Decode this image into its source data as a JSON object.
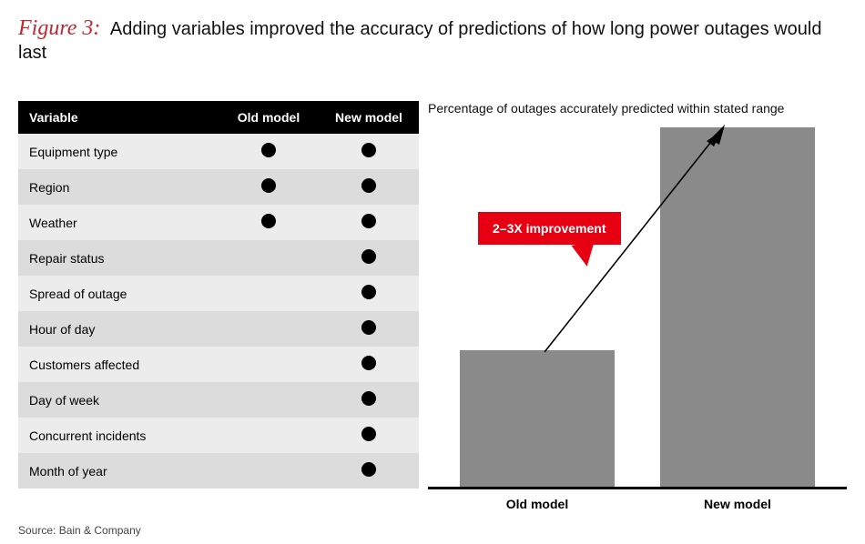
{
  "figure": {
    "number_label": "Figure 3:",
    "title": "Adding variables improved the accuracy of predictions of how long power outages would last"
  },
  "table": {
    "headers": {
      "variable": "Variable",
      "old": "Old model",
      "new": "New model"
    },
    "rows": [
      {
        "label": "Equipment type",
        "old": true,
        "new": true
      },
      {
        "label": "Region",
        "old": true,
        "new": true
      },
      {
        "label": "Weather",
        "old": true,
        "new": true
      },
      {
        "label": "Repair status",
        "old": false,
        "new": true
      },
      {
        "label": "Spread of outage",
        "old": false,
        "new": true
      },
      {
        "label": "Hour of day",
        "old": false,
        "new": true
      },
      {
        "label": "Customers affected",
        "old": false,
        "new": true
      },
      {
        "label": "Day of week",
        "old": false,
        "new": true
      },
      {
        "label": "Concurrent incidents",
        "old": false,
        "new": true
      },
      {
        "label": "Month of year",
        "old": false,
        "new": true
      }
    ]
  },
  "chart_data": {
    "type": "bar",
    "title": "Percentage of outages accurately predicted within stated range",
    "categories": [
      "Old model",
      "New model"
    ],
    "values": [
      38,
      100
    ],
    "ylim": [
      0,
      100
    ],
    "xlabel": "",
    "ylabel": "",
    "annotation": "2–3X improvement"
  },
  "source": "Source: Bain & Company"
}
